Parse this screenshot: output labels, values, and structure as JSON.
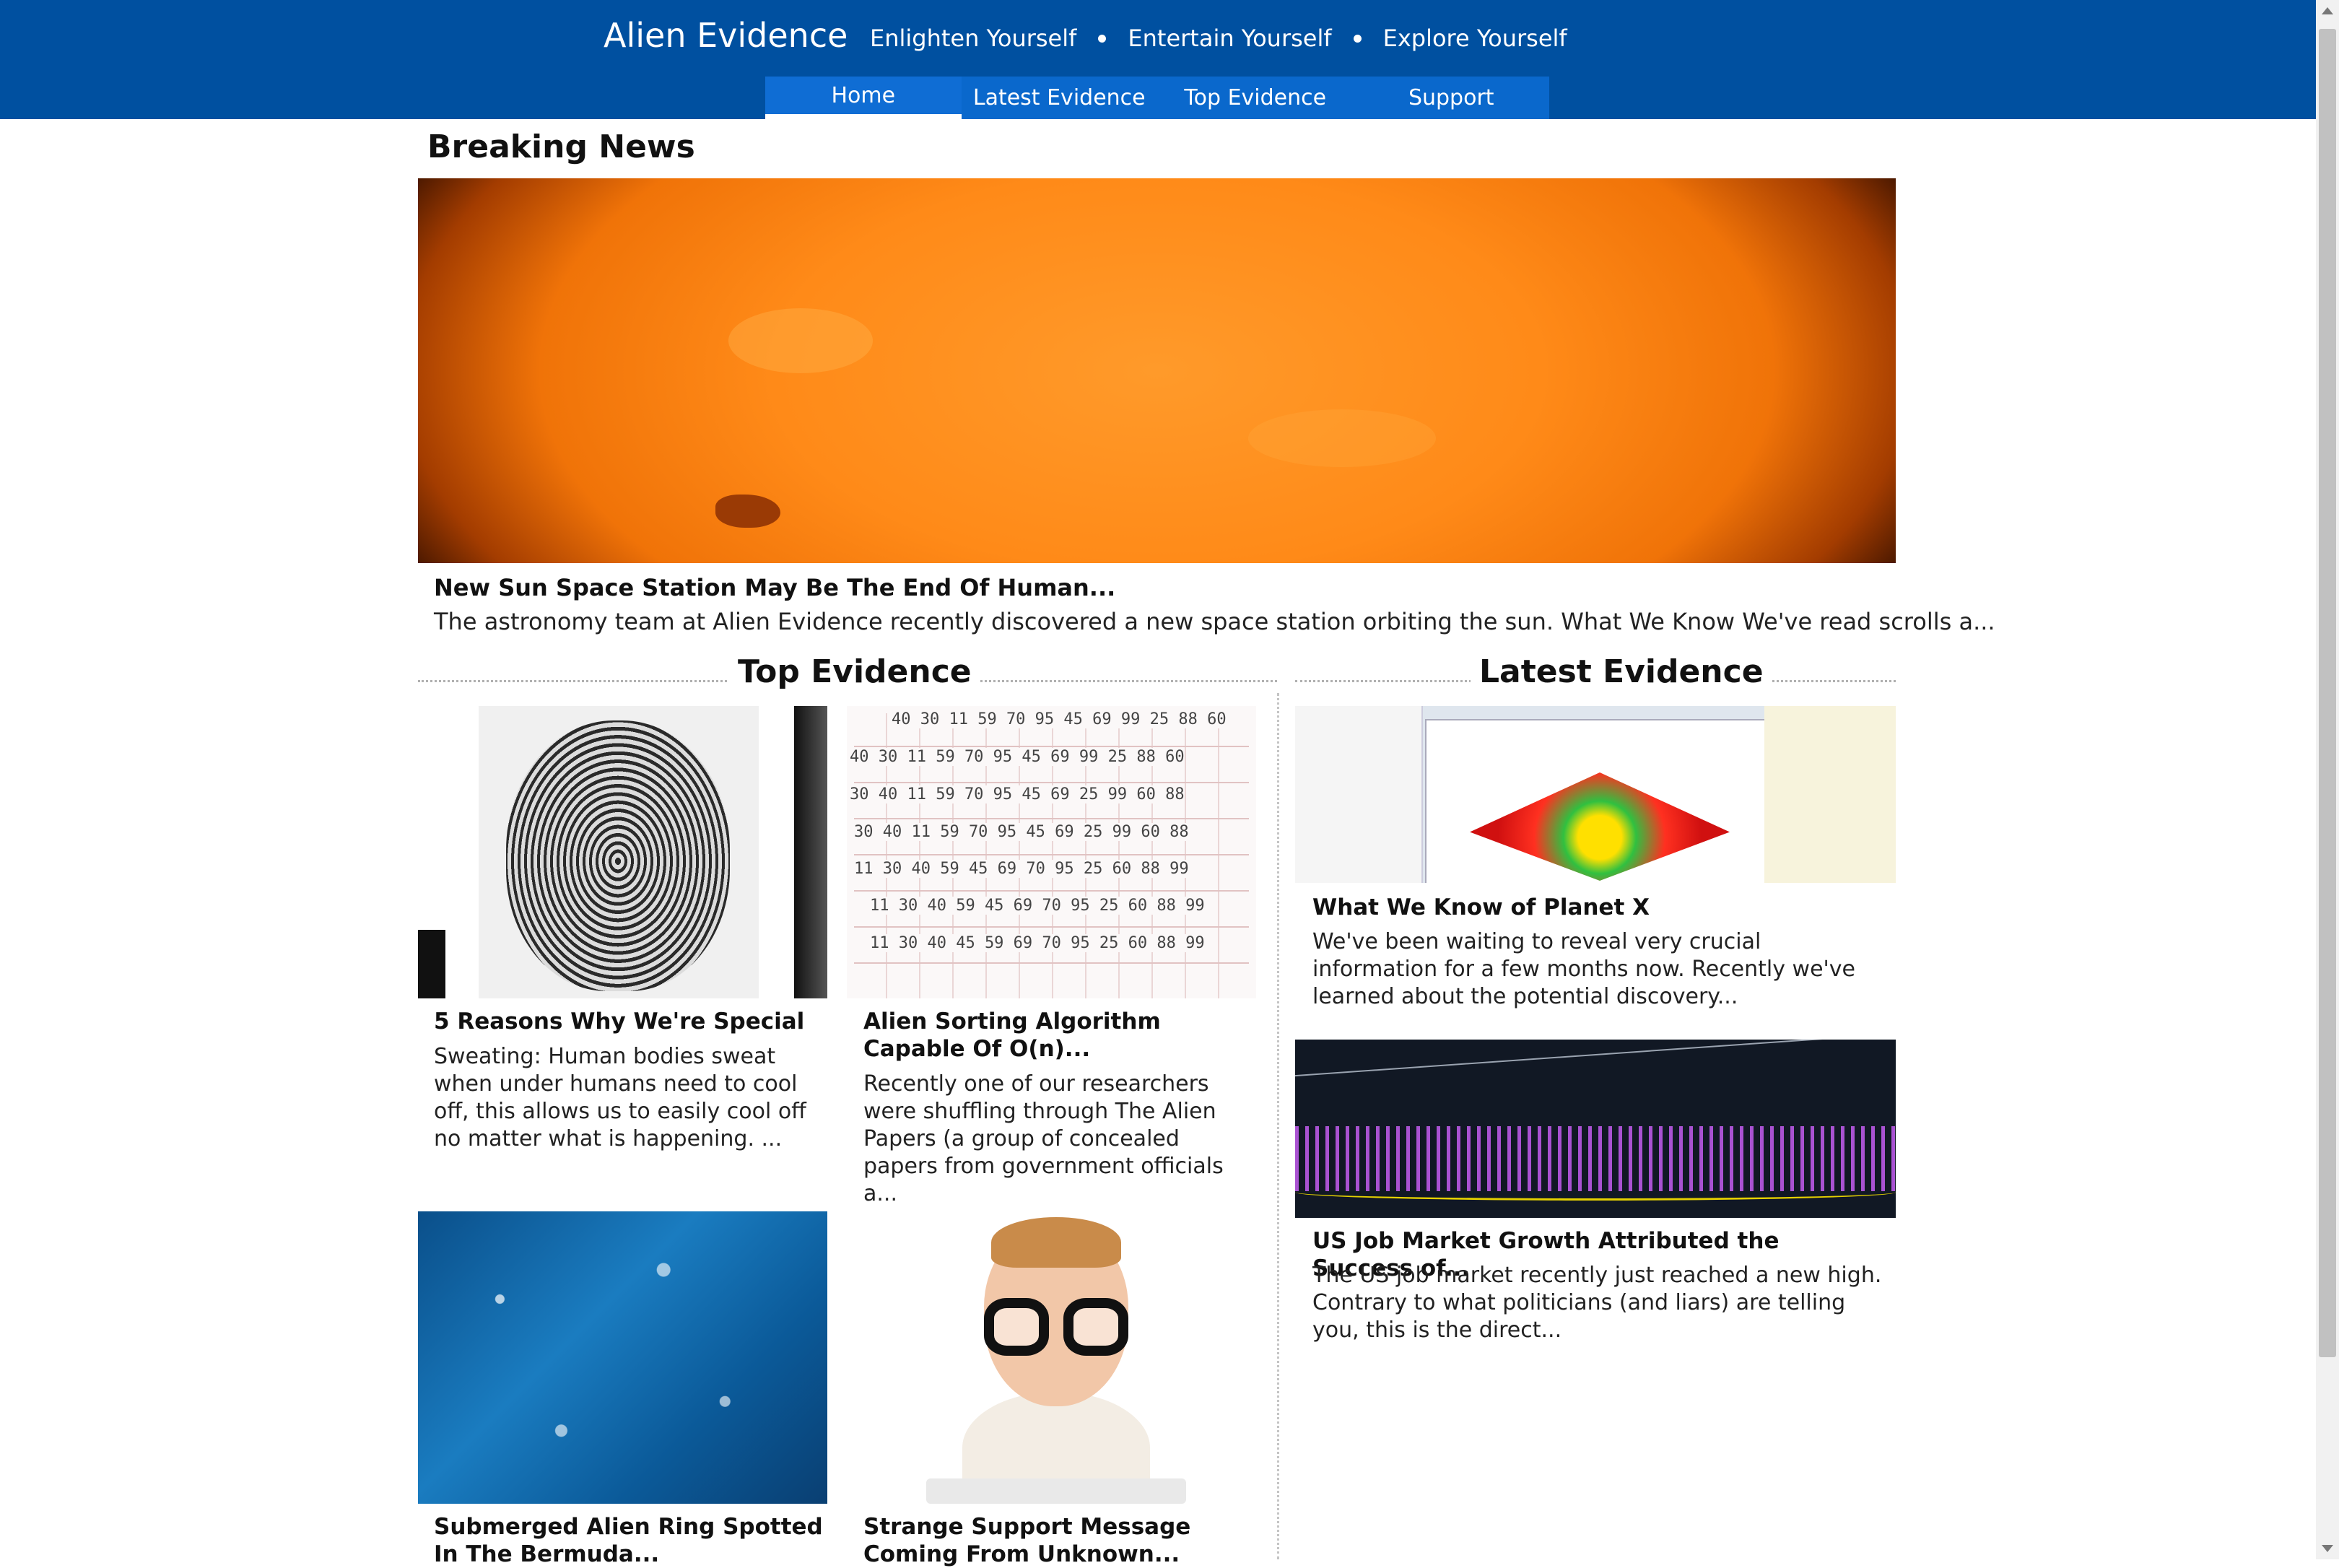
{
  "header": {
    "brand": "Alien Evidence",
    "tagline": [
      "Enlighten Yourself",
      "Entertain Yourself",
      "Explore Yourself"
    ],
    "nav": [
      {
        "label": "Home",
        "active": true
      },
      {
        "label": "Latest Evidence",
        "active": false
      },
      {
        "label": "Top Evidence",
        "active": false
      },
      {
        "label": "Support",
        "active": false
      }
    ]
  },
  "colors": {
    "header_bg": "#0050a0",
    "nav_bg": "#0a68cc"
  },
  "breaking": {
    "heading": "Breaking News",
    "image_icon": "sun-image",
    "title": "New Sun Space Station May Be The End Of Human...",
    "description": "The astronomy team at Alien Evidence recently discovered a new space station orbiting the sun. What We Know We've read scrolls a..."
  },
  "top_evidence": {
    "heading": "Top Evidence",
    "cards": [
      {
        "image_icon": "fingerprint-image",
        "title": "5 Reasons Why We're Special",
        "description": "Sweating: Human bodies sweat when under humans need to cool off, this allows us to easily cool off no matter what is happening. ..."
      },
      {
        "image_icon": "sorting-diagram-image",
        "title": "Alien Sorting Algorithm Capable Of O(n)...",
        "description": "Recently one of our researchers were shuffling through The Alien Papers (a group of concealed papers from government officials a..."
      },
      {
        "image_icon": "ocean-image",
        "title": "Submerged Alien Ring Spotted In The Bermuda...",
        "description": ""
      },
      {
        "image_icon": "nerd-image",
        "title": "Strange Support Message Coming From Unknown...",
        "description": ""
      }
    ]
  },
  "sort_image_labels": [
    "40 30 11 59 70 95 45 69 99 25 88 60",
    "40 30   11 59   70 95   45 69   99 25   88 60",
    "30 40   11 59   70 95   45 69   25 99   60 88",
    "30 40 11 59    70 95 45 69    25 99 60 88",
    "11 30 40 59    45 69 70 95    25 60 88 99",
    "11 30 40 59 45 69 70 95    25 60 88 99",
    "11 30 40 45 59 69 70 95    25 60 88 99"
  ],
  "latest_evidence": {
    "heading": "Latest Evidence",
    "cards": [
      {
        "image_icon": "planet-x-screenshot",
        "title": "What We Know of Planet X",
        "description": "We've been waiting to reveal very crucial information for a few months now. Recently we've learned about the potential discovery..."
      },
      {
        "image_icon": "stock-chart-image",
        "title": "US Job Market Growth Attributed the Success of...",
        "description": "The US job market recently just reached a new high. Contrary to what politicians (and liars) are telling you, this is the direct..."
      }
    ]
  }
}
